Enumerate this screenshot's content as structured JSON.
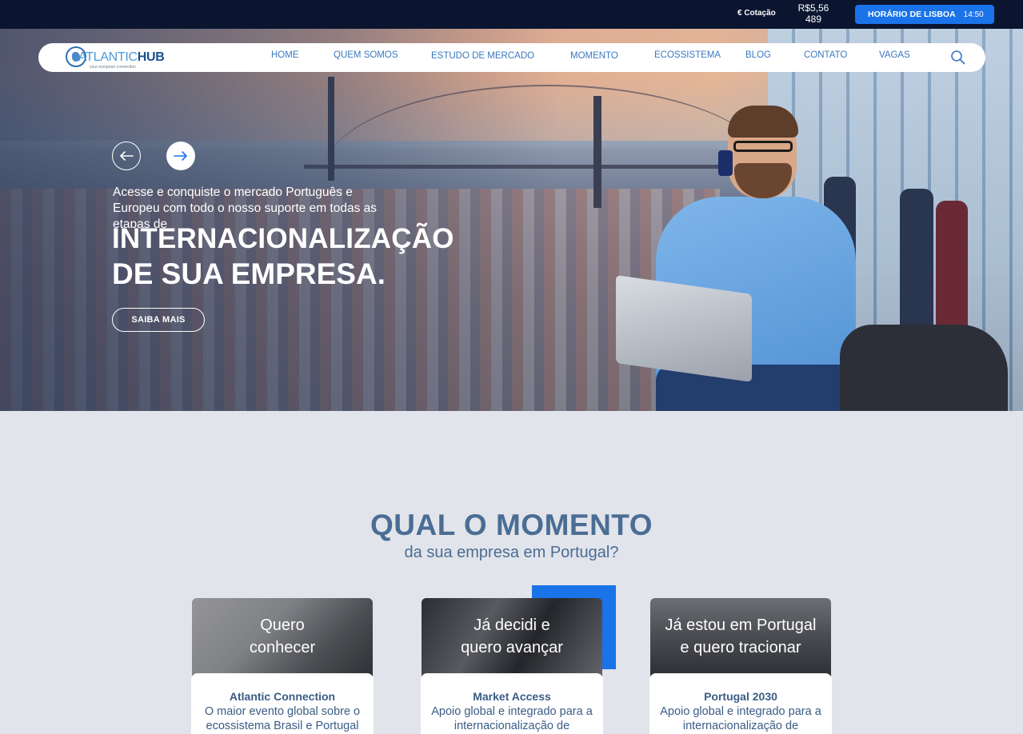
{
  "topbar": {
    "cotacao_label": "€ Cotação",
    "cotacao_value": "R$5,56 489",
    "horario_label": "HORÁRIO DE LISBOA",
    "horario_time": "14:50"
  },
  "nav": {
    "logo_part1": "ATLANTIC",
    "logo_part2": "HUB",
    "logo_tagline": "your european connection",
    "items": [
      {
        "label": "HOME"
      },
      {
        "label": "QUEM SOMOS"
      },
      {
        "label": "ESTUDO DE MERCADO"
      },
      {
        "label": "MOMENTO"
      },
      {
        "label": "ECOSSISTEMA"
      },
      {
        "label": "BLOG"
      },
      {
        "label": "CONTATO"
      },
      {
        "label": "VAGAS"
      }
    ]
  },
  "hero": {
    "subtitle": "Acesse e conquiste o mercado Português e Europeu com todo o nosso suporte em todas as etapas de",
    "title_bold": "INTERNACIONALIZAÇÃO",
    "title_regular": "DE SUA EMPRESA.",
    "cta_label": "SAIBA MAIS"
  },
  "section": {
    "title": "QUAL O MOMENTO",
    "subtitle": "da sua empresa em Portugal?"
  },
  "cards": [
    {
      "photo_line1": "Quero",
      "photo_line2": "conhecer",
      "title": "Atlantic Connection",
      "desc": "O maior evento global sobre o ecossistema Brasil e Portugal"
    },
    {
      "photo_line1": "Já decidi e",
      "photo_line2": "quero avançar",
      "title": "Market Access",
      "desc": "Apoio global e integrado para a internacionalização de"
    },
    {
      "photo_line1": "Já estou em Portugal",
      "photo_line2": "e quero tracionar",
      "title": "Portugal 2030",
      "desc": "Apoio global e integrado para a internacionalização de"
    }
  ],
  "colors": {
    "topbar_bg": "#0b1530",
    "accent": "#1a73e8",
    "nav_text": "#3978c2",
    "heading": "#4a6d94",
    "section_bg": "#e1e4ea"
  }
}
